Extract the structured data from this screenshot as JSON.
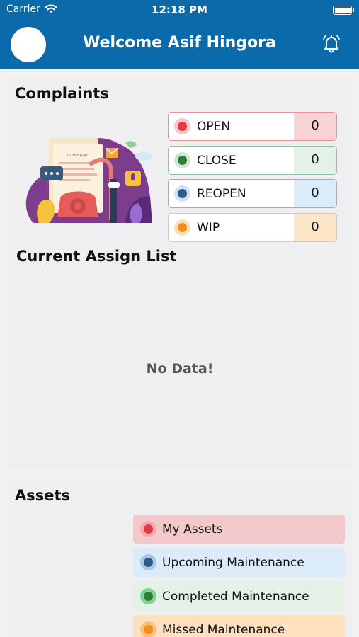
{
  "status_bar": {
    "carrier": "Carrier",
    "time": "12:18 PM"
  },
  "header": {
    "title": "Welcome Asif Hingora"
  },
  "complaints": {
    "title": "Complaints",
    "statuses": [
      {
        "label": "OPEN",
        "count": "0",
        "color": "#e53944"
      },
      {
        "label": "CLOSE",
        "count": "0",
        "color": "#2e7d3c"
      },
      {
        "label": "REOPEN",
        "count": "0",
        "color": "#2e5c8a"
      },
      {
        "label": "WIP",
        "count": "0",
        "color": "#f39019"
      }
    ]
  },
  "assign_list": {
    "title": "Current Assign List",
    "empty_text": "No Data!"
  },
  "assets": {
    "title": "Assets",
    "items": [
      {
        "label": "My Assets",
        "color": "#e53944"
      },
      {
        "label": "Upcoming Maintenance",
        "color": "#2e5c8a"
      },
      {
        "label": "Completed Maintenance",
        "color": "#2e7d3c"
      },
      {
        "label": "Missed Maintenance",
        "color": "#f39019"
      }
    ]
  }
}
